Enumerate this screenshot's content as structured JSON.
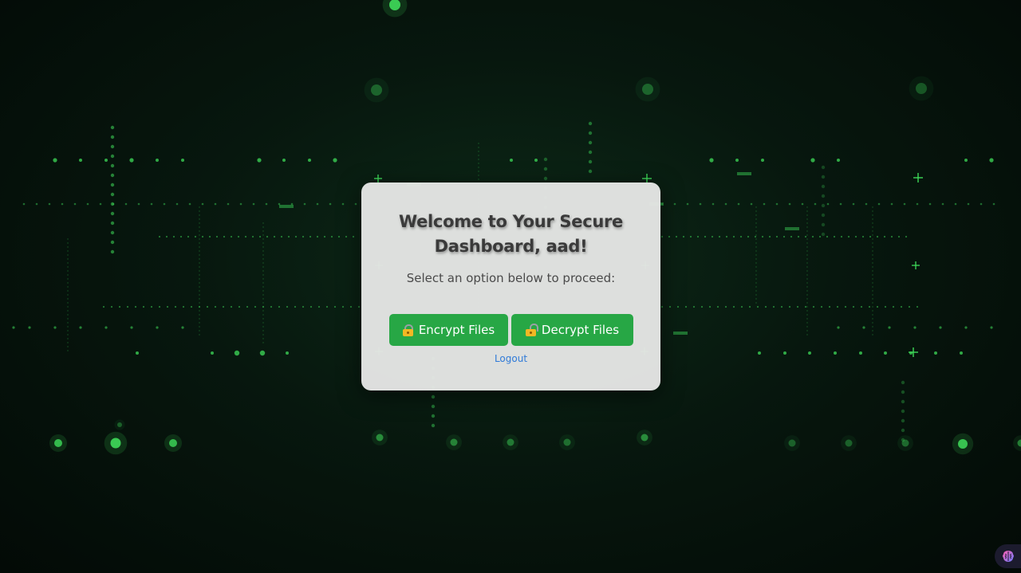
{
  "card": {
    "title": "Welcome to Your Secure Dashboard, aad!",
    "subtitle": "Select an option below to proceed:",
    "encrypt_label": "Encrypt Files",
    "decrypt_label": "Decrypt Files",
    "logout_label": "Logout"
  },
  "icons": {
    "encrypt": "locked-padlock-icon",
    "decrypt": "unlocked-padlock-icon",
    "badge": "brain-icon"
  },
  "colors": {
    "background": "#07170e",
    "particle_green": "#3fdc5a",
    "card_bg": "#e4e5e4",
    "button_green": "#27a745",
    "link_blue": "#2f7ad8",
    "title_text": "#3a3a3a"
  }
}
